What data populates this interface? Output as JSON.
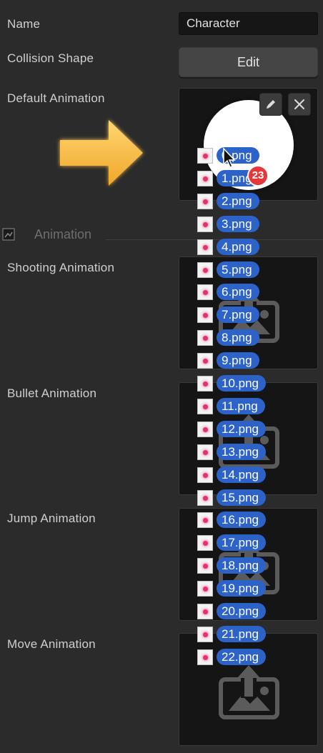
{
  "fields": {
    "name_label": "Name",
    "name_value": "Character",
    "collision_label": "Collision Shape",
    "edit_label": "Edit",
    "default_anim_label": "Default Animation"
  },
  "section": {
    "title": "Animation",
    "icon": "sprite-icon"
  },
  "slots": [
    {
      "label": "Shooting Animation",
      "icon": "image-upload-icon"
    },
    {
      "label": "Bullet Animation",
      "icon": "image-upload-icon"
    },
    {
      "label": "Jump Animation",
      "icon": "image-upload-icon"
    },
    {
      "label": "Move Animation",
      "icon": "image-upload-icon"
    }
  ],
  "drag": {
    "count_badge": "23",
    "files": [
      "0.png",
      "1.png",
      "2.png",
      "3.png",
      "4.png",
      "5.png",
      "6.png",
      "7.png",
      "8.png",
      "9.png",
      "10.png",
      "11.png",
      "12.png",
      "13.png",
      "14.png",
      "15.png",
      "16.png",
      "17.png",
      "18.png",
      "19.png",
      "20.png",
      "21.png",
      "22.png"
    ]
  },
  "colors": {
    "pill": "#2d63c9",
    "badge": "#e5383b",
    "arrow": "#f5b73a",
    "background": "#2b2b2b"
  }
}
